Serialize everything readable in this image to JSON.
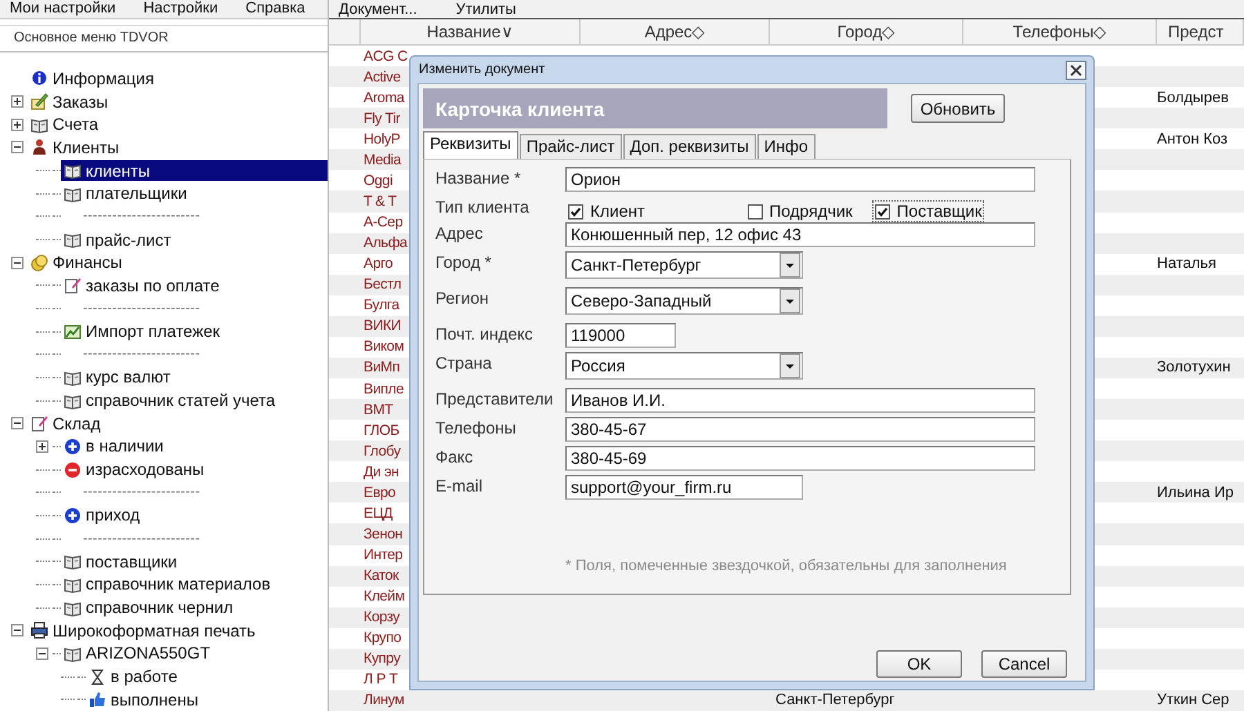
{
  "sidebar": {
    "menu": [
      "Мои настройки",
      "Настройки",
      "Справка"
    ],
    "title": "Основное меню TDVOR",
    "tree": [
      {
        "label": "Информация",
        "kind": "info",
        "selected": false
      },
      {
        "label": "Заказы",
        "kind": "orders",
        "selected": false,
        "expanded": false
      },
      {
        "label": "Счета",
        "kind": "book",
        "selected": false,
        "expanded": false
      },
      {
        "label": "Клиенты",
        "kind": "clients",
        "selected": false,
        "expanded": true,
        "children": [
          {
            "label": "клиенты",
            "kind": "book",
            "selected": true
          },
          {
            "label": "плательщики",
            "kind": "book",
            "selected": false
          },
          {
            "label": "------------------------",
            "kind": "separator"
          },
          {
            "label": "прайс-лист",
            "kind": "book",
            "selected": false
          }
        ]
      },
      {
        "label": "Финансы",
        "kind": "finance",
        "selected": false,
        "expanded": true,
        "children": [
          {
            "label": "заказы по оплате",
            "kind": "document",
            "selected": false
          },
          {
            "label": "------------------------",
            "kind": "separator"
          },
          {
            "label": "Импорт платежек",
            "kind": "chart",
            "selected": false
          },
          {
            "label": "------------------------",
            "kind": "separator"
          },
          {
            "label": "курс валют",
            "kind": "book",
            "selected": false
          },
          {
            "label": "справочник статей учета",
            "kind": "book",
            "selected": false
          }
        ]
      },
      {
        "label": "Склад",
        "kind": "document",
        "selected": false,
        "expanded": true,
        "children": [
          {
            "label": "в наличии",
            "kind": "plus",
            "selected": false,
            "expanded": false
          },
          {
            "label": "израсходованы",
            "kind": "minus",
            "selected": false
          },
          {
            "label": "------------------------",
            "kind": "separator"
          },
          {
            "label": "приход",
            "kind": "plus",
            "selected": false
          },
          {
            "label": "------------------------",
            "kind": "separator"
          },
          {
            "label": "поставщики",
            "kind": "book",
            "selected": false
          },
          {
            "label": "справочник материалов",
            "kind": "book",
            "selected": false
          },
          {
            "label": "справочник чернил",
            "kind": "book",
            "selected": false
          }
        ]
      },
      {
        "label": "Широкоформатная печать",
        "kind": "printer",
        "selected": false,
        "expanded": true,
        "children": [
          {
            "label": "ARIZONA550GT",
            "kind": "book",
            "selected": false,
            "expanded": true,
            "children": [
              {
                "label": "в работе",
                "kind": "hourglass",
                "selected": false
              },
              {
                "label": "выполнены",
                "kind": "thumb",
                "selected": false
              }
            ]
          }
        ]
      }
    ]
  },
  "menu": [
    "Документ...",
    "Утилиты"
  ],
  "table": {
    "columns": [
      {
        "label": "Название",
        "sort": "∨"
      },
      {
        "label": "Адрес",
        "sort": "◇"
      },
      {
        "label": "Город",
        "sort": "◇"
      },
      {
        "label": "Телефоны",
        "sort": "◇"
      },
      {
        "label": "Предст"
      }
    ],
    "rows": [
      {
        "name": "ACG C"
      },
      {
        "name": "Active"
      },
      {
        "name": "Aroma",
        "representative": "Болдырев"
      },
      {
        "name": "Fly Tir"
      },
      {
        "name": "HolyP",
        "representative": "Антон Коз"
      },
      {
        "name": "Media"
      },
      {
        "name": "Oggi"
      },
      {
        "name": "T & T"
      },
      {
        "name": "А-Сер"
      },
      {
        "name": "Альфа"
      },
      {
        "name": "Арго",
        "representative": "Наталья"
      },
      {
        "name": "Бестл"
      },
      {
        "name": "Булга"
      },
      {
        "name": "ВИКИ"
      },
      {
        "name": "Виком"
      },
      {
        "name": "ВиМп",
        "representative": "Золотухин"
      },
      {
        "name": "Випле"
      },
      {
        "name": "ВМТ"
      },
      {
        "name": "ГЛОБ"
      },
      {
        "name": "Глобу"
      },
      {
        "name": "Ди эн"
      },
      {
        "name": "Евро",
        "representative": "Ильина Ир"
      },
      {
        "name": "ЕЦД"
      },
      {
        "name": "Зенон"
      },
      {
        "name": "Интер"
      },
      {
        "name": "Каток"
      },
      {
        "name": "Клейм"
      },
      {
        "name": "Корзу"
      },
      {
        "name": "Крупо"
      },
      {
        "name": "Купру"
      },
      {
        "name": "Л Р Т"
      },
      {
        "name": "Линум",
        "city": "Санкт-Петербург",
        "representative": "Уткин Сер"
      }
    ]
  },
  "dialog": {
    "title": "Изменить документ",
    "header": "Карточка клиента",
    "refresh_button": "Обновить",
    "tabs": [
      {
        "label": "Реквизиты",
        "selected": true
      },
      {
        "label": "Прайс-лист",
        "selected": false
      },
      {
        "label": "Доп. реквизиты",
        "selected": false
      },
      {
        "label": "Инфо",
        "selected": false
      }
    ],
    "fields": [
      {
        "label": "Название *",
        "kind": "text",
        "value": "Орион"
      },
      {
        "label": "Тип клиента",
        "kind": "checks",
        "options": [
          {
            "label": "Клиент",
            "checked": true,
            "focused": false
          },
          {
            "label": "Подрядчик",
            "checked": false,
            "focused": false
          },
          {
            "label": "Поставщик",
            "checked": true,
            "focused": true
          }
        ]
      },
      {
        "label": "Адрес",
        "kind": "text",
        "value": "Конюшенный пер, 12 офис 43"
      },
      {
        "label": "Город *",
        "kind": "combo",
        "value": "Санкт-Петербург"
      },
      {
        "label": "Регион",
        "kind": "combo",
        "value": "Северо-Западный"
      },
      {
        "label": "Почт. индекс",
        "kind": "postcode",
        "value": "119000"
      },
      {
        "label": "Страна",
        "kind": "combo",
        "value": "Россия"
      },
      {
        "label": "Представители",
        "kind": "text",
        "value": "Иванов И.И."
      },
      {
        "label": "Телефоны",
        "kind": "text",
        "value": "380-45-67"
      },
      {
        "label": "Факс",
        "kind": "text",
        "value": "380-45-69"
      },
      {
        "label": "E-mail",
        "kind": "email",
        "value": "support@your_firm.ru"
      }
    ],
    "note": "* Поля, помеченные звездочкой, обязательны для заполнения",
    "buttons": [
      "OK",
      "Cancel"
    ]
  }
}
